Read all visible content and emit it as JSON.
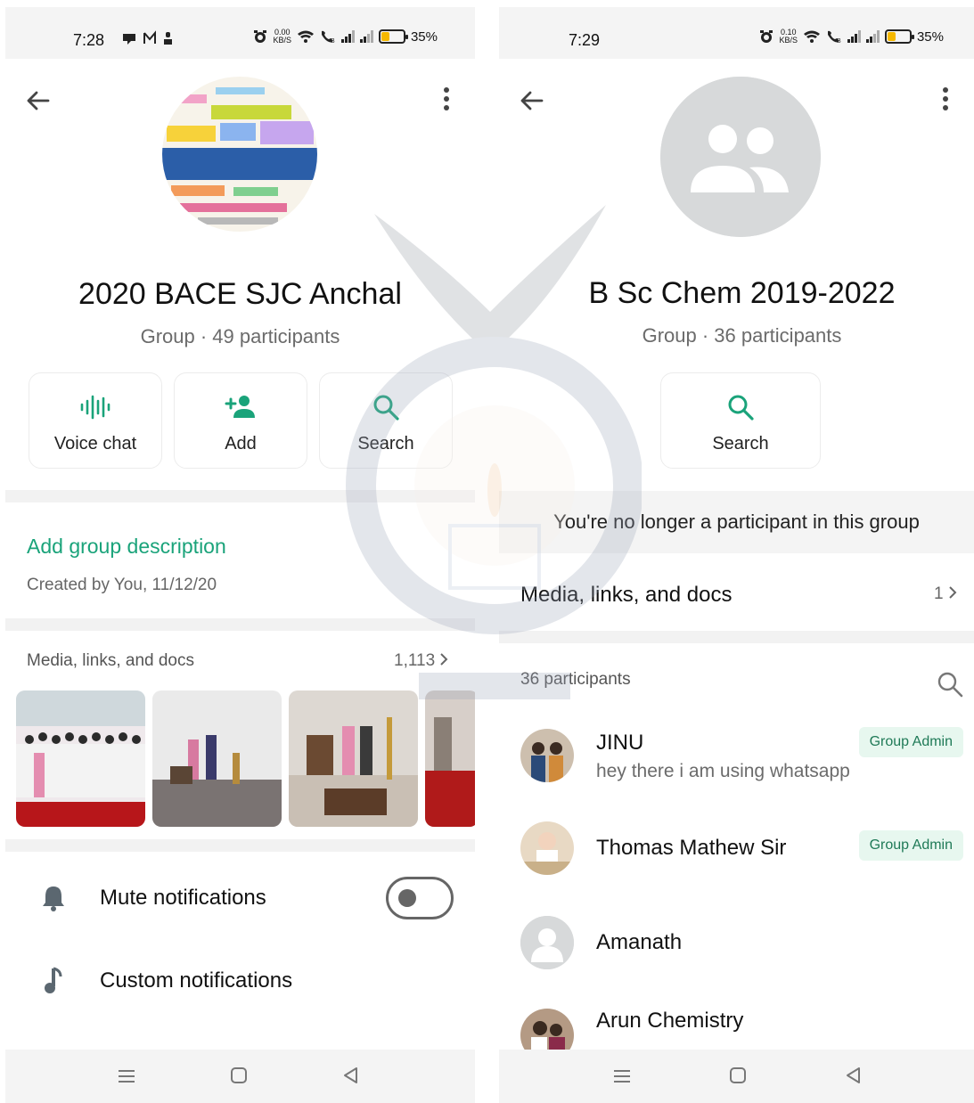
{
  "left": {
    "status": {
      "time": "7:28",
      "speed_value": "0.00",
      "speed_unit": "KB/S",
      "battery": "35%"
    },
    "group_name": "2020 BACE SJC Anchal",
    "group_info": "Group · 49 participants",
    "actions": [
      {
        "label": "Voice chat",
        "icon": "voice-chat-icon"
      },
      {
        "label": "Add",
        "icon": "add-person-icon"
      },
      {
        "label": "Search",
        "icon": "search-icon"
      }
    ],
    "description_link": "Add group description",
    "created_by": "Created by You, 11/12/20",
    "media": {
      "title": "Media, links, and docs",
      "count": "1,113"
    },
    "settings": [
      {
        "label": "Mute notifications",
        "icon": "bell-icon"
      },
      {
        "label": "Custom notifications",
        "icon": "music-note-icon"
      }
    ]
  },
  "right": {
    "status": {
      "time": "7:29",
      "speed_value": "0.10",
      "speed_unit": "KB/S",
      "battery": "35%"
    },
    "group_name": "B Sc Chem 2019-2022",
    "group_info": "Group · 36 participants",
    "action": {
      "label": "Search",
      "icon": "search-icon"
    },
    "notice": "You're no longer a participant in this group",
    "media": {
      "title": "Media, links, and docs",
      "count": "1"
    },
    "participants_header": "36 participants",
    "participants": [
      {
        "name": "JINU",
        "status": "hey there i am using whatsapp",
        "badge": "Group Admin"
      },
      {
        "name": "Thomas Mathew Sir",
        "status": "",
        "badge": "Group Admin"
      },
      {
        "name": "Amanath",
        "status": "",
        "badge": ""
      },
      {
        "name": "Arun Chemistry",
        "status": "",
        "badge": ""
      }
    ]
  },
  "colors": {
    "accent_green": "#1aa37a",
    "badge_bg": "#e7f7ef",
    "battery": "#f5b800",
    "placeholder_avatar": "#d7d9da"
  }
}
